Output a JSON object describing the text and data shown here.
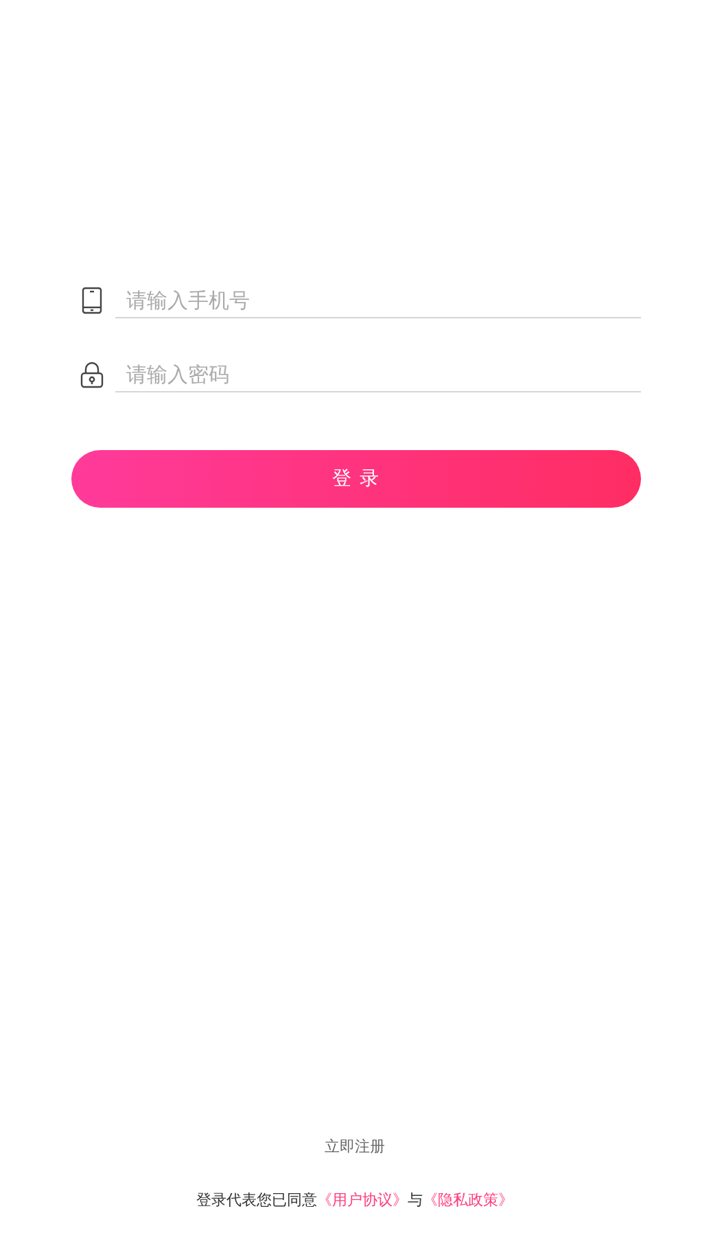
{
  "fields": [
    {
      "kind": "phone",
      "placeholder": "请输入手机号"
    },
    {
      "kind": "password",
      "placeholder": "请输入密码"
    }
  ],
  "login_button": "登 录",
  "register_link": "立即注册",
  "agreement": {
    "text": "登录代表您已同意",
    "terms_link": "《用户协议》",
    "conjunction": "与",
    "privacy_link": "《隐私政策》"
  }
}
